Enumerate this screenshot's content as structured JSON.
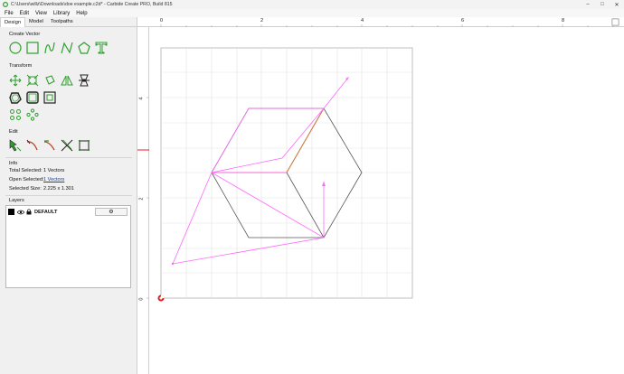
{
  "window": {
    "title": "C:\\Users\\willz\\Downloads\\doe example.c2d* - Carbide Create PRO, Build 815",
    "controls": [
      "–",
      "□",
      "✕"
    ]
  },
  "menu": {
    "items": [
      "File",
      "Edit",
      "View",
      "Library",
      "Help"
    ]
  },
  "tabs": [
    "Design",
    "Model",
    "Toolpaths"
  ],
  "create_vector": {
    "label": "Create Vector",
    "tools": [
      "circle-icon",
      "rectangle-icon",
      "curve-icon",
      "polyline-icon",
      "polygon-icon",
      "text-icon"
    ]
  },
  "transform": {
    "label": "Transform",
    "tools_row1": [
      "move-icon",
      "scale-icon",
      "rotate-icon",
      "mirror-icon",
      "align-icon"
    ],
    "tools_row2": [
      "offset-icon",
      "boolean-icon",
      "group-icon"
    ],
    "tools_row3": [
      "circle-array-icon",
      "grid-array-icon"
    ]
  },
  "edit": {
    "label": "Edit",
    "tools": [
      "node-edit-icon",
      "trim-icon",
      "join-icon",
      "cut-icon",
      "bounding-box-icon"
    ]
  },
  "info": {
    "label": "Info",
    "total_selected_label": "Total Selected:",
    "total_selected_value": "1 Vectors",
    "open_selected_label": "Open Selected:",
    "open_selected_value": "1 Vectors",
    "selected_size_label": "Selected Size:",
    "selected_size_value": "2.225 x 1.301"
  },
  "layers": {
    "label": "Layers",
    "items": [
      {
        "name": "DEFAULT",
        "color": "#000000"
      }
    ]
  },
  "ruler": {
    "top_labels": [
      "0",
      "2",
      "4",
      "6",
      "8"
    ],
    "left_labels": [
      "4",
      "2",
      "0"
    ]
  },
  "colors": {
    "accent_green": "#2e9e2e",
    "selection_pink": "#ff66ff",
    "selected_orange": "#c87a3e",
    "vector_gray": "#555555",
    "origin_red": "#e02020"
  }
}
